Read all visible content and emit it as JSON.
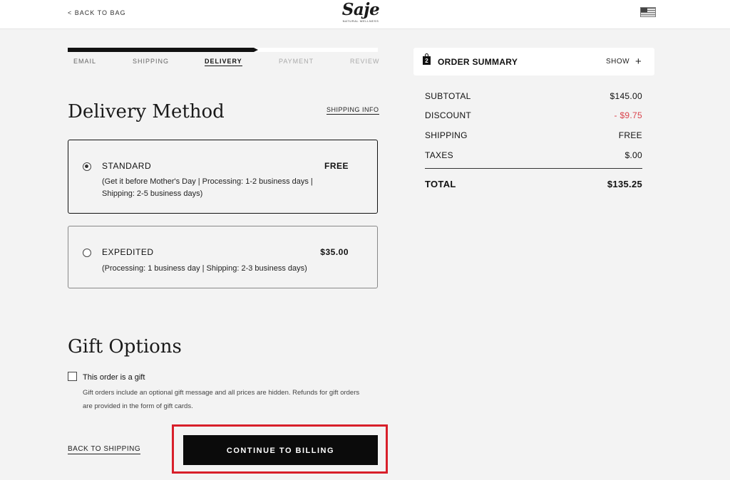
{
  "header": {
    "back_label": "< BACK TO BAG",
    "logo_text": "Saje",
    "logo_sub": "NATURAL WELLNESS",
    "region_flag": "us-flag-icon"
  },
  "progress": {
    "fill_fraction": 0.6,
    "steps": [
      "EMAIL",
      "SHIPPING",
      "DELIVERY",
      "PAYMENT",
      "REVIEW"
    ],
    "active_step": "DELIVERY"
  },
  "delivery": {
    "title": "Delivery Method",
    "shipping_info_link": "SHIPPING INFO",
    "methods": [
      {
        "name": "STANDARD",
        "price": "FREE",
        "description": "(Get it before Mother's Day | Processing: 1-2 business days | Shipping: 2-5 business days)",
        "selected": true
      },
      {
        "name": "EXPEDITED",
        "price": "$35.00",
        "description": "(Processing: 1 business day | Shipping: 2-3 business days)",
        "selected": false
      }
    ]
  },
  "gift": {
    "title": "Gift Options",
    "checkbox_label": "This order is a gift",
    "checked": false,
    "note": "Gift orders include an optional gift message and all prices are hidden. Refunds for gift orders are provided in the form of gift cards."
  },
  "actions": {
    "back_label": "BACK TO SHIPPING",
    "continue_label": "CONTINUE TO BILLING"
  },
  "summary": {
    "bag_count": "2",
    "title": "ORDER SUMMARY",
    "show_label": "SHOW",
    "subtotal_label": "SUBTOTAL",
    "subtotal_value": "$145.00",
    "discount_label": "DISCOUNT",
    "discount_value": "- $9.75",
    "shipping_label": "SHIPPING",
    "shipping_value": "FREE",
    "taxes_label": "TAXES",
    "taxes_value": "$.00",
    "total_label": "TOTAL",
    "total_value": "$135.25"
  },
  "colors": {
    "background": "#f3f3f3",
    "accent": "#0b0b0b",
    "discount": "#d9434c",
    "highlight": "#d81f2a"
  }
}
